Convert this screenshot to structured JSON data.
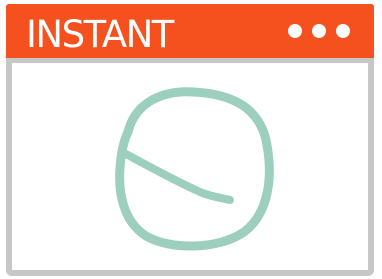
{
  "window": {
    "title": "INSTANT",
    "titlebar_color": "#f4511e",
    "frame_color": "#c7c7c7",
    "menu_icon": "more-horizontal-icon"
  },
  "illustration": {
    "icon": "clock-icon",
    "stroke_color": "#9dcfbf"
  }
}
